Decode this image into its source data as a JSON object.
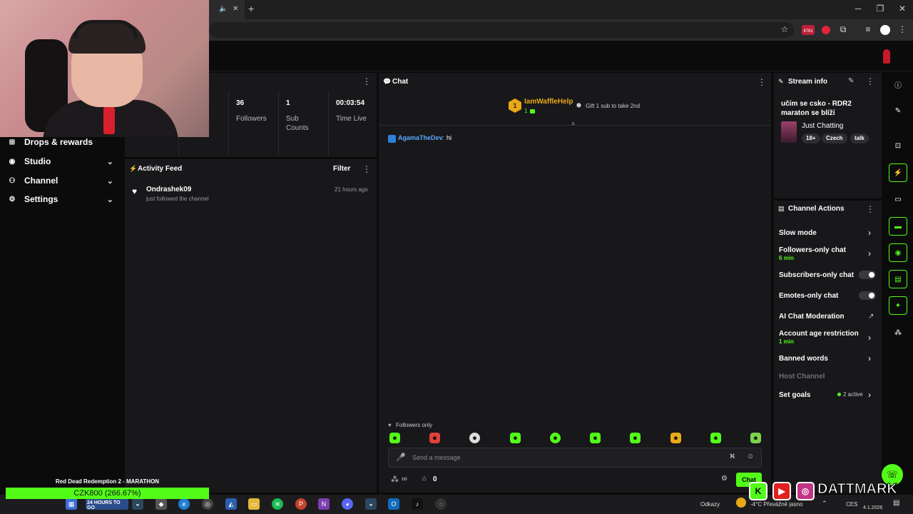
{
  "browser": {
    "tab_close": "✕",
    "new_tab": "+",
    "window_min": "─",
    "window_restore": "❐",
    "window_close": "✕",
    "ext_badge": "4781"
  },
  "sidebar": {
    "items": [
      {
        "label": "Drops & rewards",
        "icon": "gift-icon"
      },
      {
        "label": "Studio",
        "icon": "studio-icon"
      },
      {
        "label": "Channel",
        "icon": "channel-icon"
      },
      {
        "label": "Settings",
        "icon": "gear-icon"
      }
    ]
  },
  "stats": [
    {
      "value": "36",
      "label": "Followers"
    },
    {
      "value": "1",
      "label": "Sub Counts"
    },
    {
      "value": "00:03:54",
      "label": "Time Live"
    }
  ],
  "activity": {
    "title": "Activity Feed",
    "filter_label": "Filter",
    "items": [
      {
        "user": "Ondrashek09",
        "action": "just followed the channel",
        "time": "21 hours ago"
      }
    ]
  },
  "chat": {
    "title": "Chat",
    "pinned_user": "IamWaffleHelp",
    "pinned_rank": "1",
    "pinned_count": "1",
    "gift_text": "Gift 1 sub to take 2nd",
    "messages": [
      {
        "user": "AgamaTheDev",
        "text": "hi"
      }
    ],
    "mode_label": "Followers only",
    "input_placeholder": "Send a message",
    "bottom_count": "0",
    "send_label": "Chat"
  },
  "stream_info": {
    "title": "Stream info",
    "stream_title": "učím se csko - RDR2 maraton se blíží",
    "category": "Just Chatting",
    "tags": [
      "18+",
      "Czech",
      "talk"
    ]
  },
  "channel_actions": {
    "title": "Channel Actions",
    "rows": [
      {
        "label": "Slow mode",
        "sub": "",
        "control": "chevron"
      },
      {
        "label": "Followers-only chat",
        "sub": "6 min",
        "control": "chevron"
      },
      {
        "label": "Subscribers-only chat",
        "sub": "",
        "control": "toggle"
      },
      {
        "label": "Emotes-only chat",
        "sub": "",
        "control": "toggle"
      },
      {
        "label": "AI Chat Moderation",
        "sub": "",
        "control": "external"
      },
      {
        "label": "Account age restriction",
        "sub": "1 min",
        "control": "chevron"
      },
      {
        "label": "Banned words",
        "sub": "",
        "control": "chevron"
      },
      {
        "label": "Host Channel",
        "sub": "",
        "control": "none"
      },
      {
        "label": "Set goals",
        "sub": "",
        "control": "chevron",
        "status": "2 active"
      }
    ]
  },
  "overlay": {
    "marathon_title": "Red Dead Redemption 2 - MARATHON",
    "marathon_amount": "CZK800 (266.67%)",
    "marathon_progress": 1.0,
    "social_handle": "DATTMARK"
  },
  "taskbar": {
    "countdown": "24 HOURS TO GO",
    "odkazy": "Odkazy",
    "weather": "-4°C  Převážně jasno",
    "lang": "CES",
    "date": "4.1.2026"
  },
  "colors": {
    "accent": "#53fc18",
    "panel": "#18181b",
    "background": "#0b0b0c"
  }
}
